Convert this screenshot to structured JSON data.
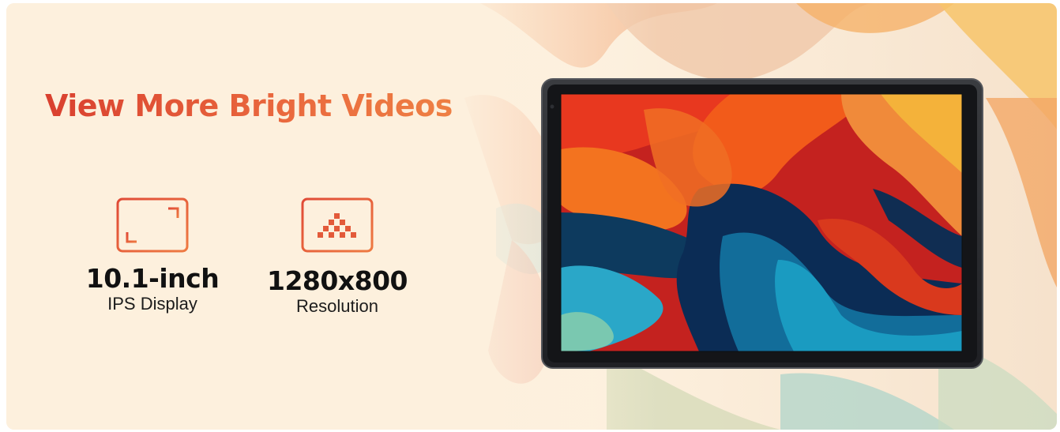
{
  "banner": {
    "headline": "View More Bright Videos",
    "accent_color": "#e2573c"
  },
  "specs": [
    {
      "icon": "screen-corners-icon",
      "value": "10.1-inch",
      "label": "IPS Display"
    },
    {
      "icon": "pixel-grid-icon",
      "value": "1280x800",
      "label": "Resolution"
    }
  ],
  "tablet": {
    "screen": "abstract-wallpaper",
    "frame_color": "#2b2d31"
  }
}
